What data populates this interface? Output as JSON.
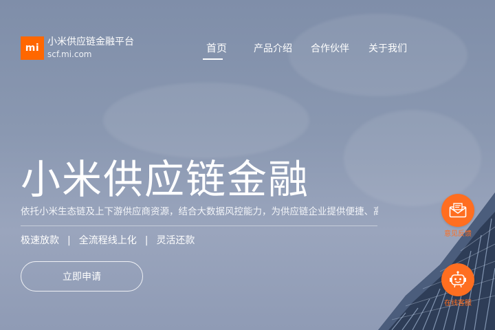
{
  "colors": {
    "accent": "#ff6700",
    "widget": "#ff6e20",
    "text": "#ffffff"
  },
  "brand": {
    "logo_text": "mi",
    "name": "小米供应链金融平台",
    "domain": "scf.mi.com"
  },
  "nav": {
    "items": [
      {
        "label": "首页",
        "active": true
      },
      {
        "label": "产品介绍",
        "active": false
      },
      {
        "label": "合作伙伴",
        "active": false
      },
      {
        "label": "关于我们",
        "active": false
      }
    ]
  },
  "hero": {
    "title": "小米供应链金融",
    "description": "依托小米生态链及上下游供应商资源，结合大数据风控能力，为供应链企业提供便捷、高效、低成本的一站式金融服务解决方案",
    "links": [
      "极速放款",
      "全流程线上化",
      "灵活还款"
    ],
    "link_separator": "|",
    "cta_label": "立即申请"
  },
  "widgets": [
    {
      "icon": "mail-icon",
      "label": "意见反馈"
    },
    {
      "icon": "robot-icon",
      "label": "在线客服"
    }
  ]
}
